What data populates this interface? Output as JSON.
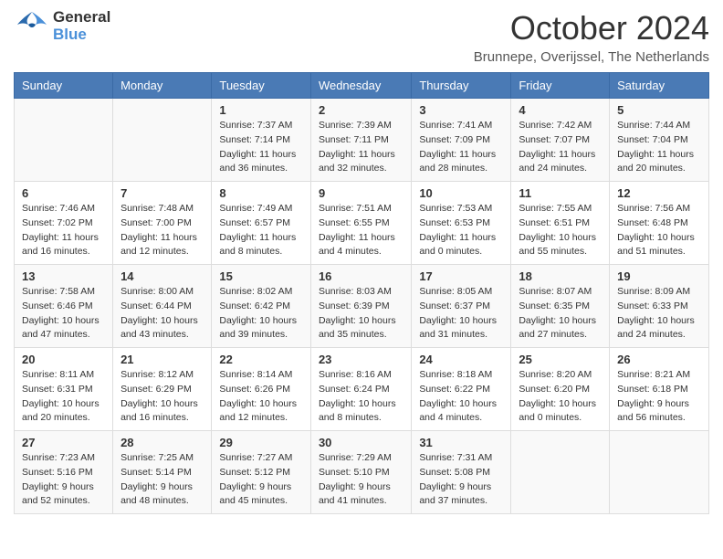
{
  "header": {
    "logo_general": "General",
    "logo_blue": "Blue",
    "title": "October 2024",
    "location": "Brunnepe, Overijssel, The Netherlands"
  },
  "weekdays": [
    "Sunday",
    "Monday",
    "Tuesday",
    "Wednesday",
    "Thursday",
    "Friday",
    "Saturday"
  ],
  "weeks": [
    [
      {
        "day": "",
        "sunrise": "",
        "sunset": "",
        "daylight": ""
      },
      {
        "day": "",
        "sunrise": "",
        "sunset": "",
        "daylight": ""
      },
      {
        "day": "1",
        "sunrise": "Sunrise: 7:37 AM",
        "sunset": "Sunset: 7:14 PM",
        "daylight": "Daylight: 11 hours and 36 minutes."
      },
      {
        "day": "2",
        "sunrise": "Sunrise: 7:39 AM",
        "sunset": "Sunset: 7:11 PM",
        "daylight": "Daylight: 11 hours and 32 minutes."
      },
      {
        "day": "3",
        "sunrise": "Sunrise: 7:41 AM",
        "sunset": "Sunset: 7:09 PM",
        "daylight": "Daylight: 11 hours and 28 minutes."
      },
      {
        "day": "4",
        "sunrise": "Sunrise: 7:42 AM",
        "sunset": "Sunset: 7:07 PM",
        "daylight": "Daylight: 11 hours and 24 minutes."
      },
      {
        "day": "5",
        "sunrise": "Sunrise: 7:44 AM",
        "sunset": "Sunset: 7:04 PM",
        "daylight": "Daylight: 11 hours and 20 minutes."
      }
    ],
    [
      {
        "day": "6",
        "sunrise": "Sunrise: 7:46 AM",
        "sunset": "Sunset: 7:02 PM",
        "daylight": "Daylight: 11 hours and 16 minutes."
      },
      {
        "day": "7",
        "sunrise": "Sunrise: 7:48 AM",
        "sunset": "Sunset: 7:00 PM",
        "daylight": "Daylight: 11 hours and 12 minutes."
      },
      {
        "day": "8",
        "sunrise": "Sunrise: 7:49 AM",
        "sunset": "Sunset: 6:57 PM",
        "daylight": "Daylight: 11 hours and 8 minutes."
      },
      {
        "day": "9",
        "sunrise": "Sunrise: 7:51 AM",
        "sunset": "Sunset: 6:55 PM",
        "daylight": "Daylight: 11 hours and 4 minutes."
      },
      {
        "day": "10",
        "sunrise": "Sunrise: 7:53 AM",
        "sunset": "Sunset: 6:53 PM",
        "daylight": "Daylight: 11 hours and 0 minutes."
      },
      {
        "day": "11",
        "sunrise": "Sunrise: 7:55 AM",
        "sunset": "Sunset: 6:51 PM",
        "daylight": "Daylight: 10 hours and 55 minutes."
      },
      {
        "day": "12",
        "sunrise": "Sunrise: 7:56 AM",
        "sunset": "Sunset: 6:48 PM",
        "daylight": "Daylight: 10 hours and 51 minutes."
      }
    ],
    [
      {
        "day": "13",
        "sunrise": "Sunrise: 7:58 AM",
        "sunset": "Sunset: 6:46 PM",
        "daylight": "Daylight: 10 hours and 47 minutes."
      },
      {
        "day": "14",
        "sunrise": "Sunrise: 8:00 AM",
        "sunset": "Sunset: 6:44 PM",
        "daylight": "Daylight: 10 hours and 43 minutes."
      },
      {
        "day": "15",
        "sunrise": "Sunrise: 8:02 AM",
        "sunset": "Sunset: 6:42 PM",
        "daylight": "Daylight: 10 hours and 39 minutes."
      },
      {
        "day": "16",
        "sunrise": "Sunrise: 8:03 AM",
        "sunset": "Sunset: 6:39 PM",
        "daylight": "Daylight: 10 hours and 35 minutes."
      },
      {
        "day": "17",
        "sunrise": "Sunrise: 8:05 AM",
        "sunset": "Sunset: 6:37 PM",
        "daylight": "Daylight: 10 hours and 31 minutes."
      },
      {
        "day": "18",
        "sunrise": "Sunrise: 8:07 AM",
        "sunset": "Sunset: 6:35 PM",
        "daylight": "Daylight: 10 hours and 27 minutes."
      },
      {
        "day": "19",
        "sunrise": "Sunrise: 8:09 AM",
        "sunset": "Sunset: 6:33 PM",
        "daylight": "Daylight: 10 hours and 24 minutes."
      }
    ],
    [
      {
        "day": "20",
        "sunrise": "Sunrise: 8:11 AM",
        "sunset": "Sunset: 6:31 PM",
        "daylight": "Daylight: 10 hours and 20 minutes."
      },
      {
        "day": "21",
        "sunrise": "Sunrise: 8:12 AM",
        "sunset": "Sunset: 6:29 PM",
        "daylight": "Daylight: 10 hours and 16 minutes."
      },
      {
        "day": "22",
        "sunrise": "Sunrise: 8:14 AM",
        "sunset": "Sunset: 6:26 PM",
        "daylight": "Daylight: 10 hours and 12 minutes."
      },
      {
        "day": "23",
        "sunrise": "Sunrise: 8:16 AM",
        "sunset": "Sunset: 6:24 PM",
        "daylight": "Daylight: 10 hours and 8 minutes."
      },
      {
        "day": "24",
        "sunrise": "Sunrise: 8:18 AM",
        "sunset": "Sunset: 6:22 PM",
        "daylight": "Daylight: 10 hours and 4 minutes."
      },
      {
        "day": "25",
        "sunrise": "Sunrise: 8:20 AM",
        "sunset": "Sunset: 6:20 PM",
        "daylight": "Daylight: 10 hours and 0 minutes."
      },
      {
        "day": "26",
        "sunrise": "Sunrise: 8:21 AM",
        "sunset": "Sunset: 6:18 PM",
        "daylight": "Daylight: 9 hours and 56 minutes."
      }
    ],
    [
      {
        "day": "27",
        "sunrise": "Sunrise: 7:23 AM",
        "sunset": "Sunset: 5:16 PM",
        "daylight": "Daylight: 9 hours and 52 minutes."
      },
      {
        "day": "28",
        "sunrise": "Sunrise: 7:25 AM",
        "sunset": "Sunset: 5:14 PM",
        "daylight": "Daylight: 9 hours and 48 minutes."
      },
      {
        "day": "29",
        "sunrise": "Sunrise: 7:27 AM",
        "sunset": "Sunset: 5:12 PM",
        "daylight": "Daylight: 9 hours and 45 minutes."
      },
      {
        "day": "30",
        "sunrise": "Sunrise: 7:29 AM",
        "sunset": "Sunset: 5:10 PM",
        "daylight": "Daylight: 9 hours and 41 minutes."
      },
      {
        "day": "31",
        "sunrise": "Sunrise: 7:31 AM",
        "sunset": "Sunset: 5:08 PM",
        "daylight": "Daylight: 9 hours and 37 minutes."
      },
      {
        "day": "",
        "sunrise": "",
        "sunset": "",
        "daylight": ""
      },
      {
        "day": "",
        "sunrise": "",
        "sunset": "",
        "daylight": ""
      }
    ]
  ]
}
